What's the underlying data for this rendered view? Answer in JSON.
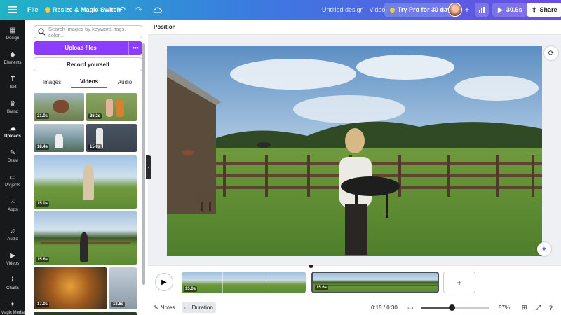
{
  "topbar": {
    "menu_icon": "hamburger-icon",
    "file_label": "File",
    "resize_label": "Resize & Magic Switch",
    "doc_title": "Untitled design - Video",
    "try_pro_label": "Try Pro for 30 days",
    "play_duration": "30.6s",
    "share_label": "Share",
    "accent": "#8b3dff"
  },
  "leftnav": {
    "items": [
      {
        "label": "Design",
        "icon": "design-icon"
      },
      {
        "label": "Elements",
        "icon": "elements-icon"
      },
      {
        "label": "Text",
        "icon": "text-icon"
      },
      {
        "label": "Brand",
        "icon": "brand-icon"
      },
      {
        "label": "Uploads",
        "icon": "upload-icon"
      },
      {
        "label": "Draw",
        "icon": "draw-icon"
      },
      {
        "label": "Projects",
        "icon": "folder-icon"
      },
      {
        "label": "Apps",
        "icon": "apps-icon"
      },
      {
        "label": "Audio",
        "icon": "music-icon"
      },
      {
        "label": "Videos",
        "icon": "video-icon"
      },
      {
        "label": "Charts",
        "icon": "chart-icon"
      },
      {
        "label": "Magic Media",
        "icon": "magic-media-icon"
      }
    ]
  },
  "panel": {
    "search_placeholder": "Search images by keyword, tags, color...",
    "upload_label": "Upload files",
    "more_label": "•••",
    "record_label": "Record yourself",
    "tabs": [
      "Images",
      "Videos",
      "Audio"
    ],
    "thumbs": [
      "21.0s",
      "26.2s",
      "18.4s",
      "15.0s",
      "15.0s",
      "15.6s",
      "17.0s",
      "18.6s"
    ]
  },
  "editor": {
    "position_label": "Position"
  },
  "timeline": {
    "clips": [
      "15.0s",
      "15.6s"
    ]
  },
  "bottombar": {
    "notes_label": "Notes",
    "duration_label": "Duration",
    "time": "0:15 / 0:30",
    "zoom": "57%",
    "zoom_fraction": 0.45
  }
}
